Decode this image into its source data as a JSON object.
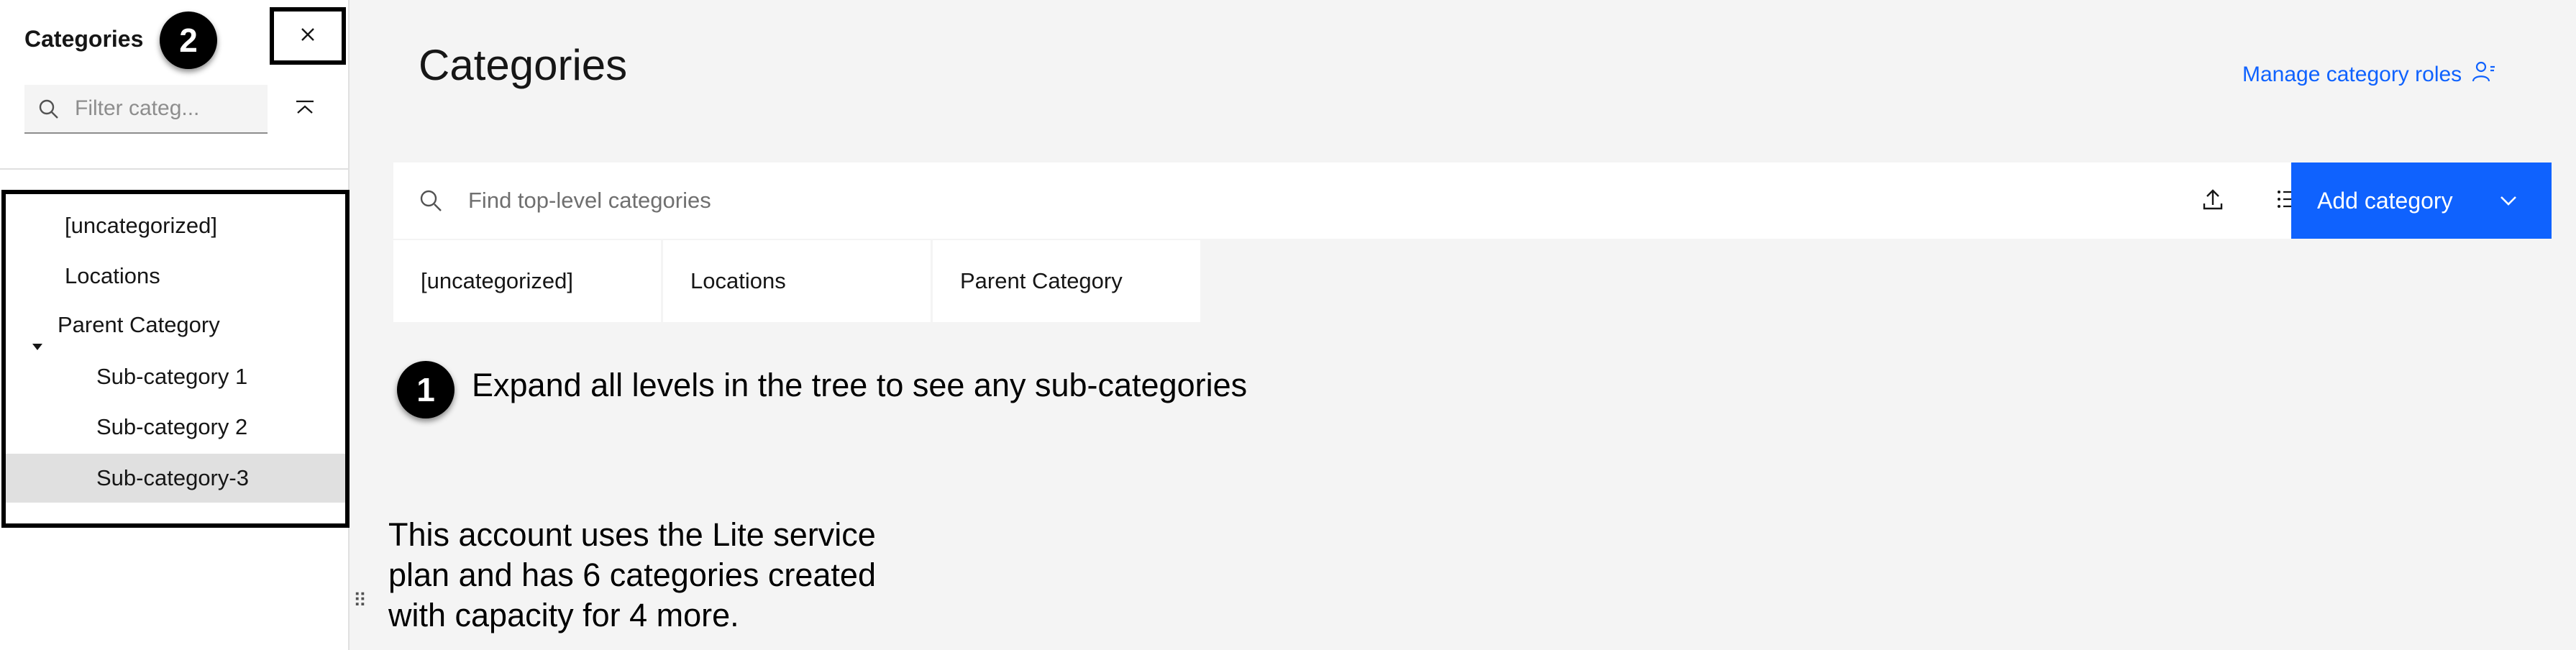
{
  "sidebar": {
    "title": "Categories",
    "filter_placeholder": "Filter categ...",
    "tree": [
      {
        "label": "[uncategorized]"
      },
      {
        "label": "Locations"
      },
      {
        "label": "Parent Category"
      },
      {
        "label": "Sub-category 1"
      },
      {
        "label": "Sub-category 2"
      },
      {
        "label": "Sub-category-3"
      }
    ]
  },
  "annotations": {
    "badge_1": "1",
    "badge_2": "2",
    "expand_hint": "Expand all levels in the tree to see any sub-categories",
    "lite_plan_note": "This account uses the Lite service plan and has 6 categories created with capacity for 4 more."
  },
  "main": {
    "title": "Categories",
    "manage_link": "Manage category roles",
    "search_placeholder": "Find top-level categories",
    "add_button": "Add category",
    "tiles": [
      {
        "label": "[uncategorized]"
      },
      {
        "label": "Locations"
      },
      {
        "label": "Parent Category"
      }
    ]
  },
  "icons": {
    "close": "close-icon",
    "search": "search-icon",
    "collapse_all": "collapse-all-icon",
    "caret": "caret-down-icon",
    "drag_handle": "drag-handle-icon",
    "user_roles": "user-roles-icon",
    "upload": "upload-icon",
    "list_view": "list-view-icon",
    "chevron_down": "chevron-down-icon"
  },
  "colors": {
    "accent": "#0f62fe",
    "background": "#f4f4f4",
    "selected_row": "#e0e0e0"
  }
}
